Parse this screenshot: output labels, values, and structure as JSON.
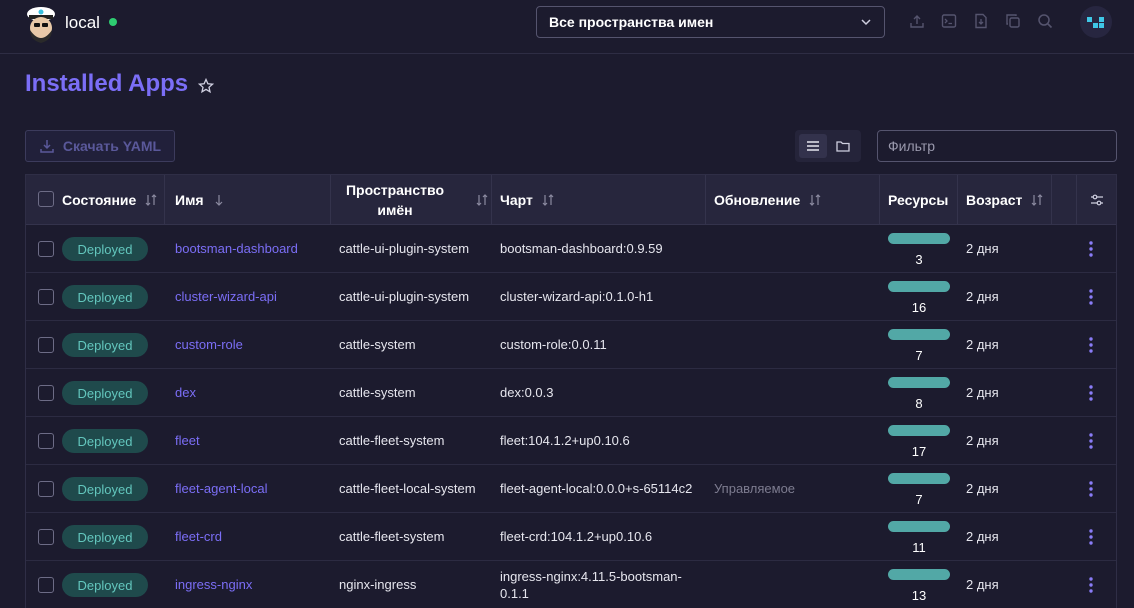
{
  "header": {
    "cluster_name": "local",
    "status_color": "#2ecc71",
    "namespace_select": "Все пространства имен"
  },
  "page": {
    "title": "Installed Apps",
    "download_yaml_label": "Скачать YAML",
    "filter_placeholder": "Фильтр"
  },
  "table": {
    "columns": {
      "state": "Состояние",
      "name": "Имя",
      "namespace": "Пространство имён",
      "chart": "Чарт",
      "upgrade": "Обновление",
      "resources": "Ресурсы",
      "age": "Возраст"
    },
    "rows": [
      {
        "state": "Deployed",
        "name": "bootsman-dashboard",
        "namespace": "cattle-ui-plugin-system",
        "chart": "bootsman-dashboard:0.9.59",
        "upgrade": "",
        "resources": "3",
        "age": "2 дня"
      },
      {
        "state": "Deployed",
        "name": "cluster-wizard-api",
        "namespace": "cattle-ui-plugin-system",
        "chart": "cluster-wizard-api:0.1.0-h1",
        "upgrade": "",
        "resources": "16",
        "age": "2 дня"
      },
      {
        "state": "Deployed",
        "name": "custom-role",
        "namespace": "cattle-system",
        "chart": "custom-role:0.0.11",
        "upgrade": "",
        "resources": "7",
        "age": "2 дня"
      },
      {
        "state": "Deployed",
        "name": "dex",
        "namespace": "cattle-system",
        "chart": "dex:0.0.3",
        "upgrade": "",
        "resources": "8",
        "age": "2 дня"
      },
      {
        "state": "Deployed",
        "name": "fleet",
        "namespace": "cattle-fleet-system",
        "chart": "fleet:104.1.2+up0.10.6",
        "upgrade": "",
        "resources": "17",
        "age": "2 дня"
      },
      {
        "state": "Deployed",
        "name": "fleet-agent-local",
        "namespace": "cattle-fleet-local-system",
        "chart": "fleet-agent-local:0.0.0+s-65114c2",
        "upgrade": "Управляемое",
        "resources": "7",
        "age": "2 дня"
      },
      {
        "state": "Deployed",
        "name": "fleet-crd",
        "namespace": "cattle-fleet-system",
        "chart": "fleet-crd:104.1.2+up0.10.6",
        "upgrade": "",
        "resources": "11",
        "age": "2 дня"
      },
      {
        "state": "Deployed",
        "name": "ingress-nginx",
        "namespace": "nginx-ingress",
        "chart": "ingress-nginx:4.11.5-bootsman-0.1.1",
        "upgrade": "",
        "resources": "13",
        "age": "2 дня"
      }
    ]
  },
  "colors": {
    "accent": "#7b6ef6",
    "badge_bg": "#1f4a4c",
    "badge_text": "#63c6bd",
    "resource_bar": "#52a8a6"
  },
  "icons": [
    "captain-logo-icon",
    "chevron-down-icon",
    "upload-icon",
    "terminal-icon",
    "download-icon",
    "copy-icon",
    "search-icon",
    "star-icon",
    "list-view-icon",
    "folder-view-icon",
    "sort-icon",
    "settings-sliders-icon",
    "kebab-menu-icon"
  ]
}
